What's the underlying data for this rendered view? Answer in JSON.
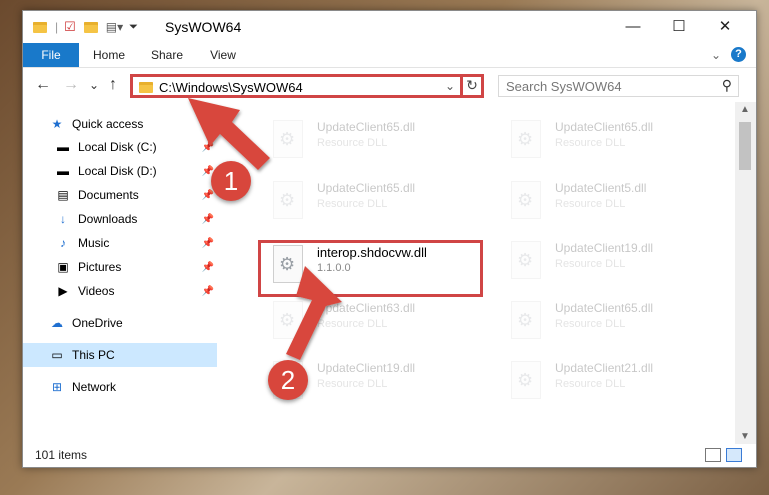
{
  "window": {
    "title": "SysWOW64",
    "minimize": "—",
    "maximize": "☐",
    "close": "✕"
  },
  "ribbon": {
    "file": "File",
    "home": "Home",
    "share": "Share",
    "view": "View",
    "expand": "⌄",
    "help": "?"
  },
  "nav": {
    "back": "←",
    "forward": "→",
    "recent": "⌄",
    "up": "↑"
  },
  "address": {
    "path": "C:\\Windows\\SysWOW64",
    "dropdown": "⌄",
    "refresh": "↻"
  },
  "search": {
    "placeholder": "Search SysWOW64",
    "icon": "⚲"
  },
  "sidebar": {
    "items": [
      {
        "label": "Quick access",
        "icon": "★",
        "color": "#1f6fd0"
      },
      {
        "label": "Local Disk (C:)",
        "icon": "▬",
        "pinned": true
      },
      {
        "label": "Local Disk (D:)",
        "icon": "▬",
        "pinned": true
      },
      {
        "label": "Documents",
        "icon": "▤",
        "pinned": true
      },
      {
        "label": "Downloads",
        "icon": "↓",
        "pinned": true,
        "color": "#1f6fd0"
      },
      {
        "label": "Music",
        "icon": "♪",
        "pinned": true,
        "color": "#1f6fd0"
      },
      {
        "label": "Pictures",
        "icon": "▣",
        "pinned": true
      },
      {
        "label": "Videos",
        "icon": "▶",
        "pinned": true
      },
      {
        "label": "OneDrive",
        "icon": "☁",
        "color": "#1f6fd0"
      },
      {
        "label": "This PC",
        "icon": "▭",
        "selected": true
      },
      {
        "label": "Network",
        "icon": "⊞",
        "color": "#1f6fd0"
      }
    ],
    "pin": "📌"
  },
  "files": [
    {
      "name": "UpdateClient65.dll",
      "type": "Resource DLL"
    },
    {
      "name": "UpdateClient65.dll",
      "type": "Resource DLL"
    },
    {
      "name": "UpdateClient65.dll",
      "type": "Resource DLL"
    },
    {
      "name": "UpdateClient5.dll",
      "type": "Resource DLL"
    },
    {
      "name": "interop.shdocvw.dll",
      "type": "1.1.0.0"
    },
    {
      "name": "UpdateClient19.dll",
      "type": "Resource DLL"
    },
    {
      "name": "UpdateClient63.dll",
      "type": "Resource DLL"
    },
    {
      "name": "UpdateClient65.dll",
      "type": "Resource DLL"
    },
    {
      "name": "UpdateClient19.dll",
      "type": "Resource DLL"
    },
    {
      "name": "UpdateClient21.dll",
      "type": "Resource DLL"
    }
  ],
  "status": {
    "count": "101 items"
  },
  "badges": {
    "one": "1",
    "two": "2"
  },
  "colors": {
    "accent": "#1979ca",
    "highlight": "#d04545"
  }
}
